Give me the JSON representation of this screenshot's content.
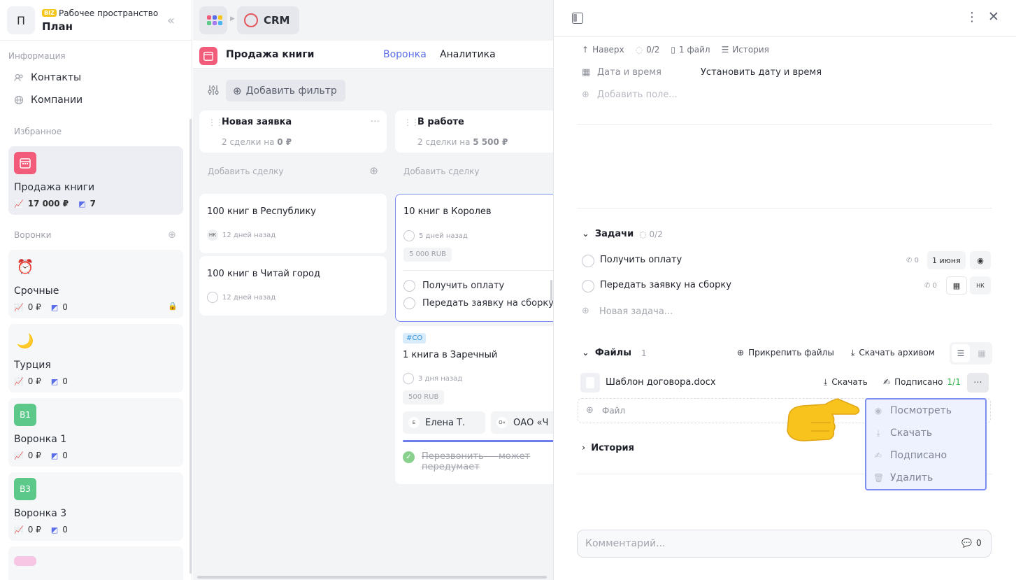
{
  "workspace": {
    "avatar": "П",
    "badge": "BIZ",
    "label": "Рабочее пространство",
    "name": "План",
    "collapse": "«"
  },
  "sidebar": {
    "info_title": "Информация",
    "info_items": [
      {
        "label": "Контакты",
        "icon": "contacts-icon"
      },
      {
        "label": "Компании",
        "icon": "globe-icon"
      }
    ],
    "fav_title": "Избранное",
    "favorite": {
      "name": "Продажа книги",
      "sum": "17 000 ₽",
      "count": "7",
      "color": "#f25c7a"
    },
    "funnels_title": "Воронки",
    "funnels": [
      {
        "name": "Срочные",
        "sum": "0 ₽",
        "count": "0",
        "icon": "⏰"
      },
      {
        "name": "Турция",
        "sum": "0 ₽",
        "count": "0",
        "icon": "🌙"
      },
      {
        "name": "Воронка 1",
        "sum": "0 ₽",
        "count": "0",
        "icon": "B1"
      },
      {
        "name": "Воронка 3",
        "sum": "0 ₽",
        "count": "0",
        "icon": "B3"
      }
    ]
  },
  "topbar": {
    "app": "CRM"
  },
  "page": {
    "title": "Продажа книги",
    "tabs": [
      "Воронка",
      "Аналитика"
    ],
    "add_filter": "Добавить фильтр"
  },
  "columns": [
    {
      "title": "Новая заявка",
      "summary_prefix": "2 сделки на ",
      "summary_value": "0 ₽",
      "add_deal": "Добавить сделку"
    },
    {
      "title": "В работе",
      "summary_prefix": "2 сделки на ",
      "summary_value": "5 500 ₽",
      "add_deal": "Добавить сделку"
    }
  ],
  "deals_new": [
    {
      "title": "100 книг в Республику",
      "avatar": "НК",
      "time": "12 дней назад"
    },
    {
      "title": "100 книг в Читай город",
      "time": "12 дней назад"
    }
  ],
  "deal_work_1": {
    "title": "10 книг в Королев",
    "time": "5 дней назад",
    "amount": "5 000 RUB",
    "tasks": [
      "Получить оплату",
      "Передать заявку на сборку"
    ]
  },
  "deal_work_2": {
    "tag": "#CO",
    "title": "1 книга в Заречный",
    "time": "3 дня назад",
    "amount": "500 RUB",
    "contact_initial": "Е",
    "contact": "Елена Т.",
    "company_initial": "О«",
    "company": "ОАО «Ч",
    "task_done": "Перезвонить — может",
    "task_done_2": "передумает"
  },
  "panel": {
    "crumbs": {
      "up": "Наверх",
      "progress": "0/2",
      "files": "1 файл",
      "history": "История"
    },
    "date_label": "Дата и время",
    "date_value": "Установить дату и время",
    "add_field": "Добавить поле...",
    "tasks_title": "Задачи",
    "tasks_count": "0/2",
    "tasks": [
      {
        "title": "Получить оплату",
        "calls": "0",
        "date": "1 июня"
      },
      {
        "title": "Передать заявку на сборку",
        "calls": "0",
        "avatar": "НК"
      }
    ],
    "new_task": "Новая задача...",
    "files_title": "Файлы",
    "files_count": "1",
    "attach": "Прикрепить файлы",
    "download_archive": "Скачать архивом",
    "file": {
      "name": "Шаблон договора.docx",
      "download": "Скачать",
      "signed": "Подписано",
      "signed_count": "1/1"
    },
    "add_file": "Файл",
    "history_title": "История",
    "comment_placeholder": "Комментарий...",
    "comment_count": "0"
  },
  "menu": [
    "Посмотреть",
    "Скачать",
    "Подписано",
    "Удалить"
  ],
  "colors": {
    "accent": "#5b6ee8",
    "signed": "#2fb344",
    "menu_border": "#7d8ef2"
  }
}
